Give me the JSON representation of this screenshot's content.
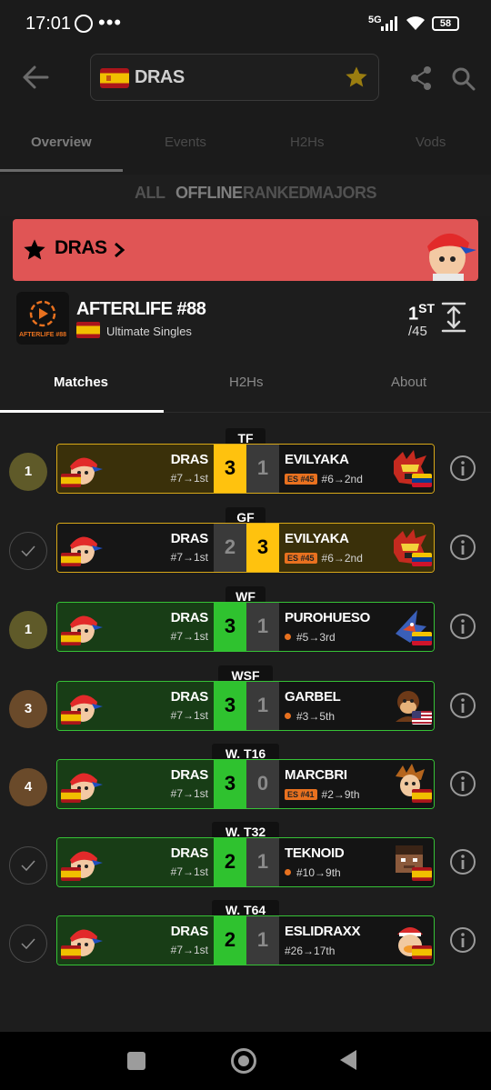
{
  "status": {
    "time": "17:01",
    "dots": "•••",
    "network": "5G",
    "battery": "58"
  },
  "header": {
    "player_name": "DRAS"
  },
  "main_tabs": [
    "Overview",
    "Events",
    "H2Hs",
    "Vods"
  ],
  "filters": [
    "ALL",
    "OFFLINE",
    "RANKED",
    "MAJORS"
  ],
  "banner": {
    "name": "DRAS"
  },
  "event": {
    "name": "AFTERLIFE #88",
    "logo_text": "AFTERLIFE #88",
    "game": "Ultimate Singles",
    "placement_num": "1",
    "placement_suffix": "ST",
    "total": "/45"
  },
  "sub_tabs": [
    "Matches",
    "H2Hs",
    "About"
  ],
  "colors": {
    "win": "#2fc22f",
    "gold": "#ffc20e",
    "loss_bg": "#3a3a3a",
    "banner": "#e05555"
  },
  "matches": [
    {
      "round": "TF",
      "badge": "1",
      "badge_color": "#5f5a29",
      "p1": "DRAS",
      "p1_seed": "#7→1st",
      "s1": "3",
      "s2": "1",
      "p2": "EVILYAKA",
      "p2_tag": "ES #45",
      "p2_seed": "#6→2nd",
      "p2_char": "incineroar-icon",
      "p2_flag": "venezuela",
      "style": "gold-left"
    },
    {
      "round": "GF",
      "badge": "",
      "badge_color": "",
      "p1": "DRAS",
      "p1_seed": "#7→1st",
      "s1": "2",
      "s2": "3",
      "p2": "EVILYAKA",
      "p2_tag": "ES #45",
      "p2_seed": "#6→2nd",
      "p2_char": "incineroar-icon",
      "p2_flag": "venezuela",
      "style": "gold-right"
    },
    {
      "round": "WF",
      "badge": "1",
      "badge_color": "#5f5a29",
      "p1": "DRAS",
      "p1_seed": "#7→1st",
      "s1": "3",
      "s2": "1",
      "p2": "PUROHUESO",
      "p2_tag": "",
      "p2_seed": "#5→3rd",
      "p2_char": "falco-icon",
      "p2_flag": "venezuela",
      "style": "green"
    },
    {
      "round": "WSF",
      "badge": "3",
      "badge_color": "#6a4a2a",
      "p1": "DRAS",
      "p1_seed": "#7→1st",
      "s1": "3",
      "s2": "1",
      "p2": "GARBEL",
      "p2_tag": "",
      "p2_seed": "#3→5th",
      "p2_char": "donkey-kong-icon",
      "p2_flag": "usa",
      "style": "green"
    },
    {
      "round": "W. T16",
      "badge": "4",
      "badge_color": "#6a4a2a",
      "p1": "DRAS",
      "p1_seed": "#7→1st",
      "s1": "3",
      "s2": "0",
      "p2": "MARCBRI",
      "p2_tag": "ES #41",
      "p2_seed": "#2→9th",
      "p2_char": "terry-icon",
      "p2_flag": "spain",
      "style": "green"
    },
    {
      "round": "W. T32",
      "badge": "",
      "badge_color": "",
      "p1": "DRAS",
      "p1_seed": "#7→1st",
      "s1": "2",
      "s2": "1",
      "p2": "TEKNOID",
      "p2_tag": "",
      "p2_seed": "#10→9th",
      "p2_char": "steve-icon",
      "p2_flag": "spain",
      "style": "green"
    },
    {
      "round": "W. T64",
      "badge": "",
      "badge_color": "",
      "p1": "DRAS",
      "p1_seed": "#7→1st",
      "s1": "2",
      "s2": "1",
      "p2": "ESLIDRAXX",
      "p2_tag": "",
      "p2_seed": "#26→17th",
      "p2_char": "king-dedede-icon",
      "p2_flag": "spain",
      "style": "green"
    }
  ]
}
